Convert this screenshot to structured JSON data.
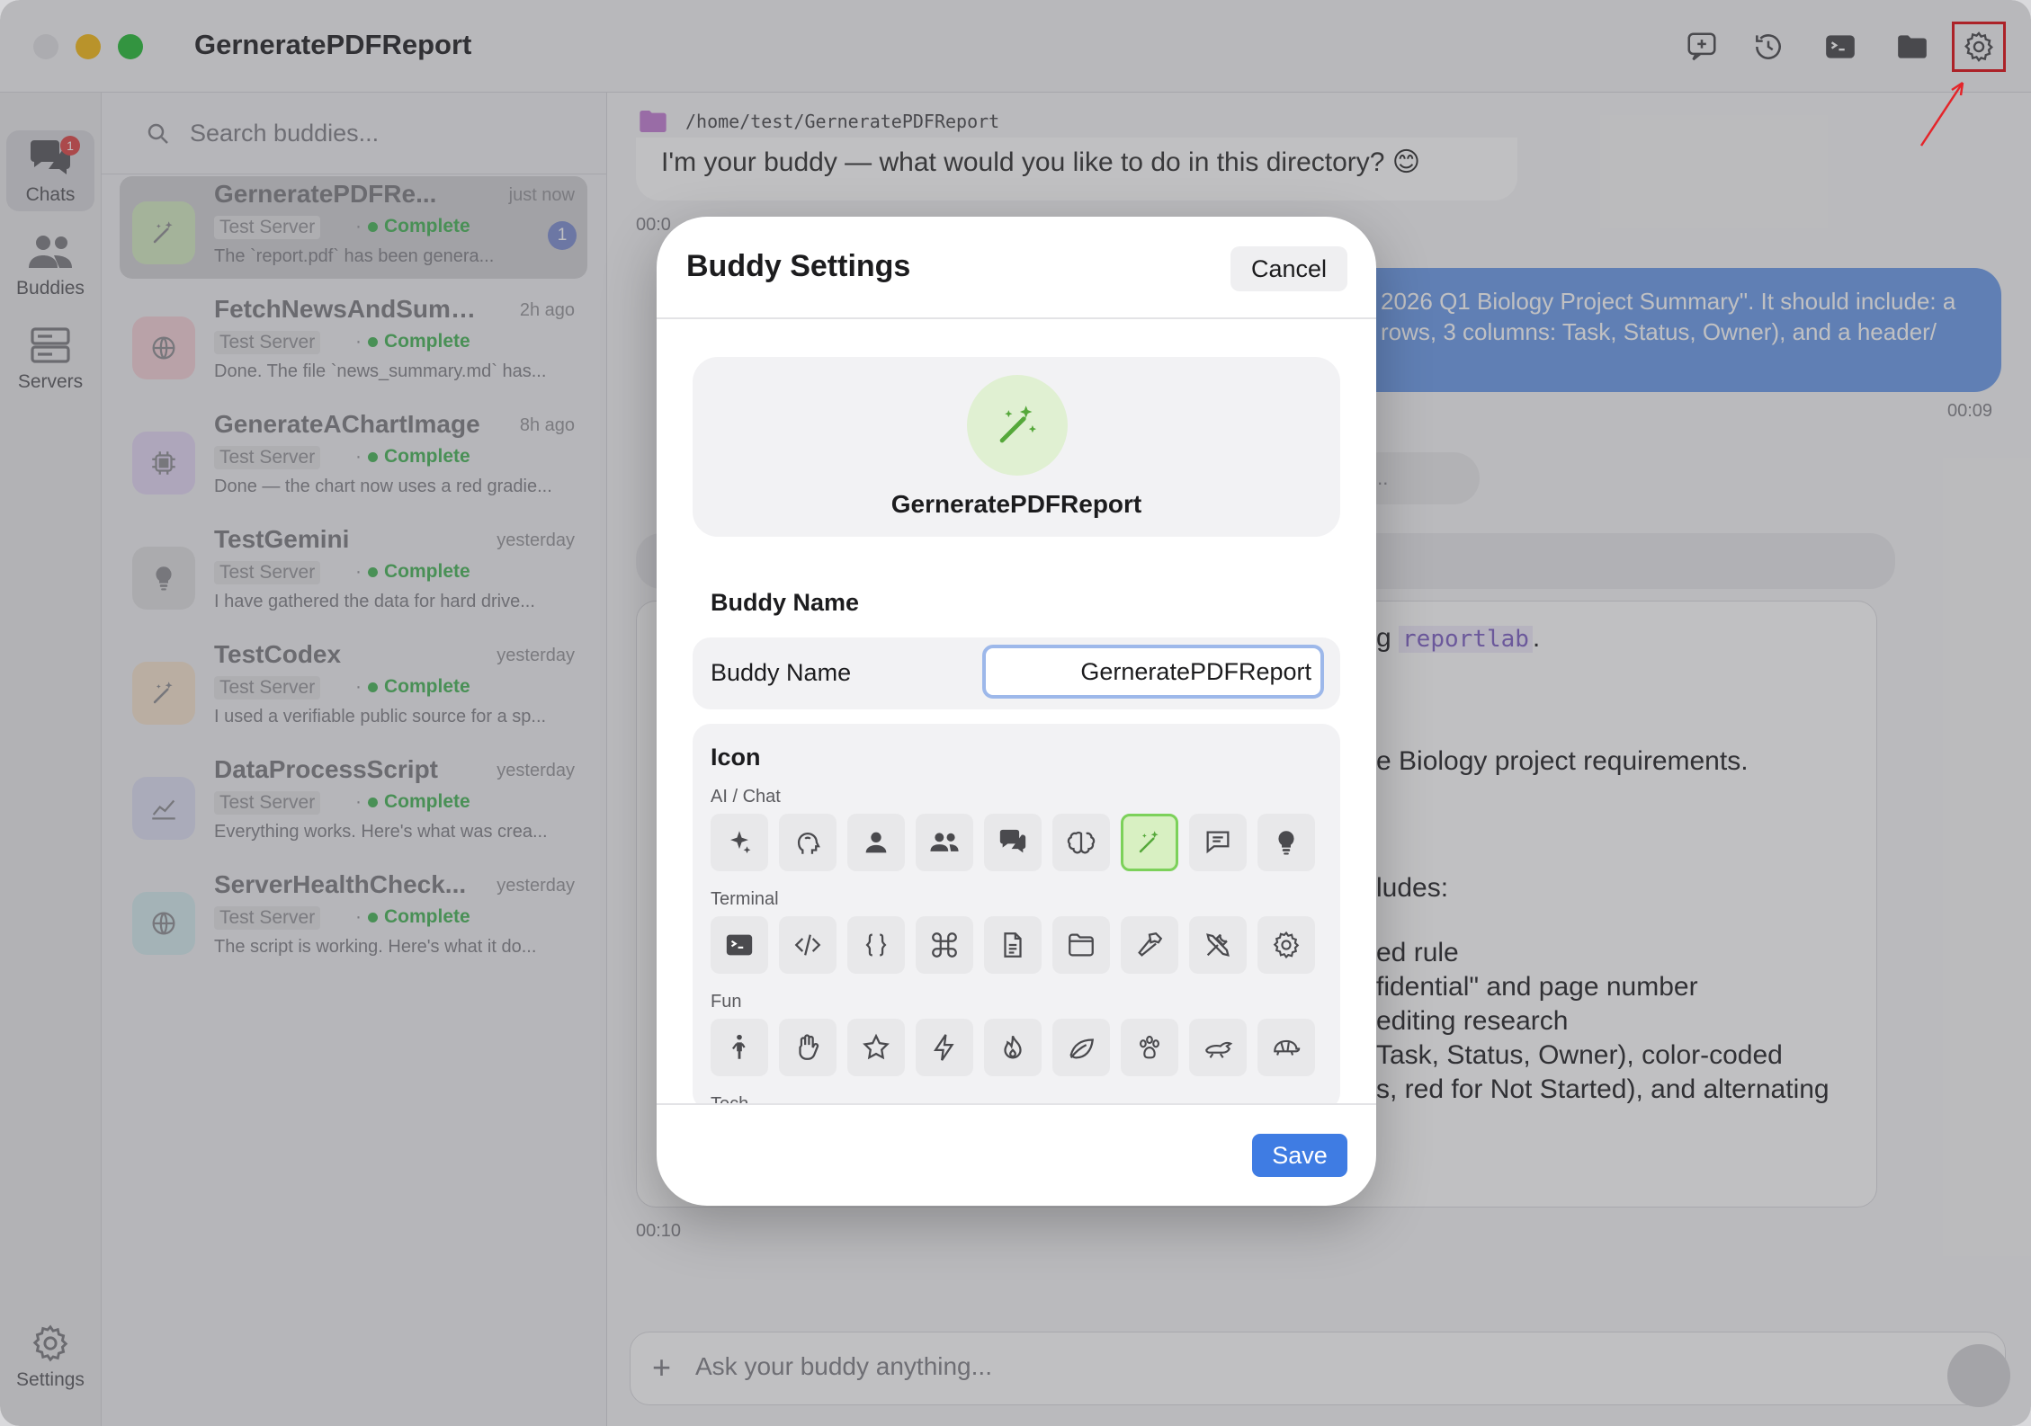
{
  "window": {
    "title": "GerneratePDFReport",
    "toolbar_icons": [
      "new-chat-icon",
      "history-icon",
      "terminal-icon",
      "folder-icon",
      "gear-icon"
    ]
  },
  "rail": {
    "chats_label": "Chats",
    "chats_badge": "1",
    "buddies_label": "Buddies",
    "servers_label": "Servers",
    "settings_label": "Settings"
  },
  "list": {
    "search_placeholder": "Search buddies...",
    "items": [
      {
        "name": "GerneratePDFRe...",
        "time": "just now",
        "server": "Test Server",
        "status": "Complete",
        "preview": "The `report.pdf` has been genera...",
        "count": "1",
        "color": "#d8eec8",
        "icon": "wand-icon"
      },
      {
        "name": "FetchNewsAndSumma...",
        "time": "2h ago",
        "server": "Test Server",
        "status": "Complete",
        "preview": "Done. The file `news_summary.md` has...",
        "color": "#f6d6db",
        "icon": "globe-icon"
      },
      {
        "name": "GenerateAChartImage",
        "time": "8h ago",
        "server": "Test Server",
        "status": "Complete",
        "preview": "Done — the chart now uses a red gradie...",
        "color": "#e6dcf6",
        "icon": "cpu-icon"
      },
      {
        "name": "TestGemini",
        "time": "yesterday",
        "server": "Test Server",
        "status": "Complete",
        "preview": "I have gathered the data for hard drive...",
        "color": "#e2e2e4",
        "icon": "lightbulb-icon"
      },
      {
        "name": "TestCodex",
        "time": "yesterday",
        "server": "Test Server",
        "status": "Complete",
        "preview": "I used a verifiable public source for a sp...",
        "color": "#f7e6d3",
        "icon": "wand-icon"
      },
      {
        "name": "DataProcessScript",
        "time": "yesterday",
        "server": "Test Server",
        "status": "Complete",
        "preview": "Everything works. Here's what was crea...",
        "color": "#e1e2f4",
        "icon": "chart-icon"
      },
      {
        "name": "ServerHealthCheck...",
        "time": "yesterday",
        "server": "Test Server",
        "status": "Complete",
        "preview": "The script is working. Here's what it do...",
        "color": "#d8eef0",
        "icon": "globe-icon"
      }
    ]
  },
  "chat": {
    "path": "/home/test/GerneratePDFReport",
    "greeting": "I'm your buddy — what would you like to do in this directory? 😊",
    "greeting_time": "00:0",
    "user_msg_line1": "2026 Q1 Biology Project Summary\". It should include: a",
    "user_msg_line2": "rows, 3 columns: Task, Status, Owner), and a header/",
    "user_msg_time": "00:09",
    "pill_text": "...",
    "resp_line1_text": "g ",
    "resp_line1_code": "reportlab",
    "resp_line1_tail": ".",
    "resp_line2": "e Biology project requirements.",
    "resp_line3": "ludes:",
    "resp_line4": "ed rule",
    "resp_line5": "fidential\" and page number",
    "resp_line6": "editing research",
    "resp_line7": "Task, Status, Owner), color-coded",
    "resp_line8": "s, red for Not Started), and alternating",
    "resp_time": "00:10",
    "composer_placeholder": "Ask your buddy anything..."
  },
  "modal": {
    "title": "Buddy Settings",
    "cancel_label": "Cancel",
    "preview_name": "GerneratePDFReport",
    "name_section": "Buddy Name",
    "name_field_label": "Buddy Name",
    "name_value": "GerneratePDFReport",
    "icon_section": "Icon",
    "categories": [
      {
        "label": "AI / Chat",
        "icons": [
          "sparkles-icon",
          "head-icon",
          "person-icon",
          "people-icon",
          "chat-bubbles-icon",
          "brain-icon",
          "wand-icon",
          "message-icon",
          "lightbulb-icon"
        ],
        "selected": 6
      },
      {
        "label": "Terminal",
        "icons": [
          "terminal-icon",
          "code-icon",
          "braces-icon",
          "command-icon",
          "document-icon",
          "folder-icon",
          "hammer-icon",
          "tools-icon",
          "gear-icon"
        ]
      },
      {
        "label": "Fun",
        "icons": [
          "figure-icon",
          "hand-icon",
          "star-icon",
          "bolt-icon",
          "flame-icon",
          "leaf-icon",
          "paw-icon",
          "hare-icon",
          "tortoise-icon"
        ]
      }
    ],
    "next_category_partial": "Tech",
    "save_label": "Save"
  }
}
